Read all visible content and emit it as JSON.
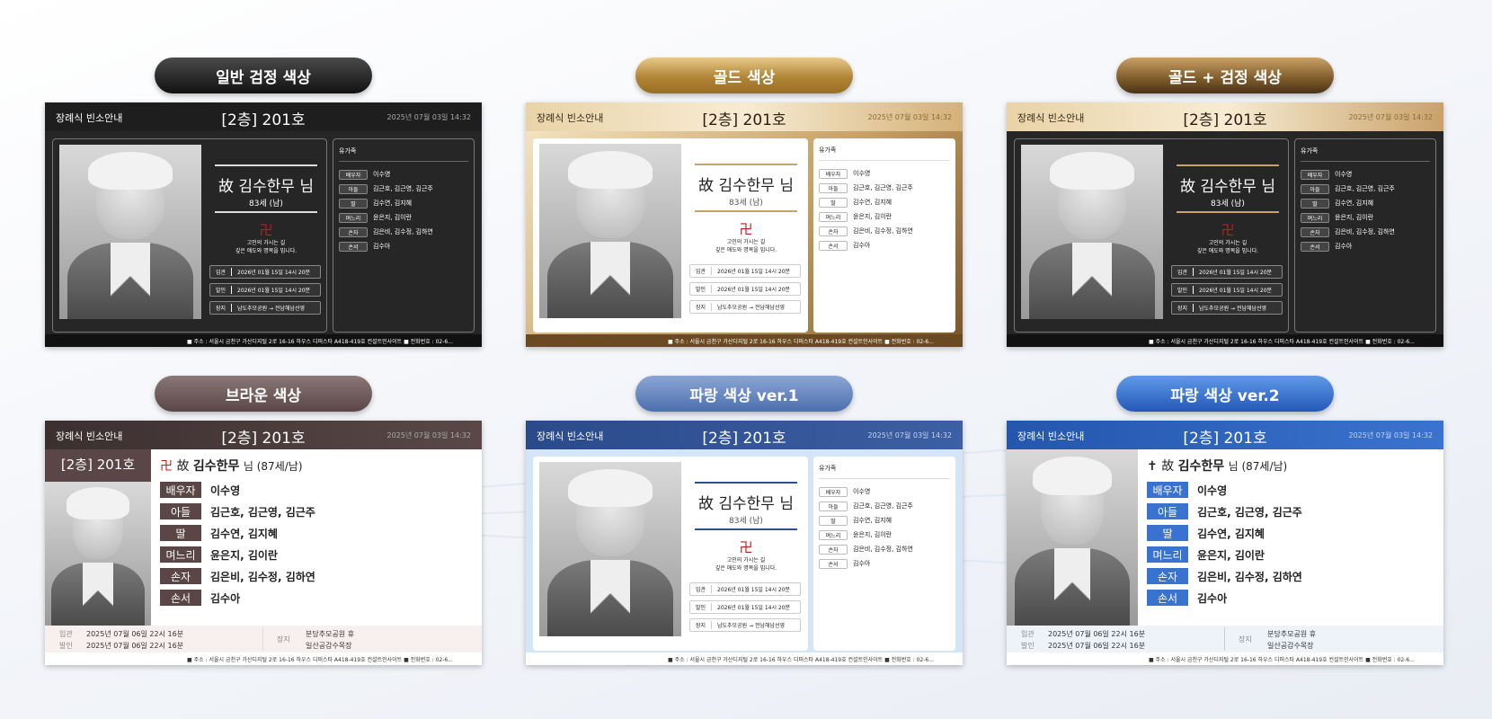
{
  "themes": [
    {
      "label": "일반 검정 색상",
      "brand": "장례식 빈소안내",
      "room": "[2층] 201호",
      "date": "2025년 07월 03일 14:32",
      "name": "故 김수한무 님",
      "age": "83세 (남)",
      "symbol": "卍",
      "message": "고인의 가시는 길\n깊은 애도와 명복을 빕니다.",
      "info": [
        {
          "k": "입관",
          "v": "2026년 01월 15일 14시 20분"
        },
        {
          "k": "발인",
          "v": "2026년 01월 15일 14시 20분"
        },
        {
          "k": "장지",
          "v": "남도추모공원 → 전남해남선영"
        }
      ],
      "family_title": "유가족",
      "family": [
        {
          "r": "배우자",
          "n": "이수영"
        },
        {
          "r": "아들",
          "n": "김근호, 김근영, 김근주"
        },
        {
          "r": "딸",
          "n": "김수연, 김지혜"
        },
        {
          "r": "며느리",
          "n": "윤은지, 김이란"
        },
        {
          "r": "손자",
          "n": "김은비, 김수정, 김하연"
        },
        {
          "r": "손서",
          "n": "김수아"
        }
      ],
      "footer": "■ 주소 : 서울시 금천구 가산디지털 2로 16-16 하우스 디퍼스타 A418-419호 컨설트인사이트    ■ 전화번호 : 02-6..."
    },
    {
      "label": "골드 색상",
      "brand": "장례식 빈소안내",
      "room": "[2층] 201호",
      "date": "2025년 07월 03일 14:32",
      "name": "故 김수한무 님",
      "age": "83세 (남)",
      "symbol": "卍",
      "message": "고인의 가시는 길\n깊은 애도와 명복을 빕니다.",
      "info": [
        {
          "k": "입관",
          "v": "2026년 01월 15일 14시 20분"
        },
        {
          "k": "발인",
          "v": "2026년 01월 15일 14시 20분"
        },
        {
          "k": "장지",
          "v": "남도추모공원 → 전남해남선영"
        }
      ],
      "family_title": "유가족",
      "family": [
        {
          "r": "배우자",
          "n": "이수영"
        },
        {
          "r": "아들",
          "n": "김근호, 김근영, 김근주"
        },
        {
          "r": "딸",
          "n": "김수연, 김지혜"
        },
        {
          "r": "며느리",
          "n": "윤은지, 김이란"
        },
        {
          "r": "손자",
          "n": "김은비, 김수정, 김하연"
        },
        {
          "r": "손서",
          "n": "김수아"
        }
      ],
      "footer": "■ 주소 : 서울시 금천구 가산디지털 2로 16-16 하우스 디퍼스타 A418-419호 컨설트인사이트    ■ 전화번호 : 02-6..."
    },
    {
      "label": "골드 + 검정 색상",
      "brand": "장례식 빈소안내",
      "room": "[2층] 201호",
      "date": "2025년 07월 03일 14:32",
      "name": "故 김수한무 님",
      "age": "83세 (남)",
      "symbol": "卍",
      "message": "고인의 가시는 길\n깊은 애도와 명복을 빕니다.",
      "info": [
        {
          "k": "입관",
          "v": "2026년 01월 15일 14시 20분"
        },
        {
          "k": "발인",
          "v": "2026년 01월 15일 14시 20분"
        },
        {
          "k": "장지",
          "v": "남도추모공원 → 전남해남선영"
        }
      ],
      "family_title": "유가족",
      "family": [
        {
          "r": "배우자",
          "n": "이수영"
        },
        {
          "r": "아들",
          "n": "김근호, 김근영, 김근주"
        },
        {
          "r": "딸",
          "n": "김수연, 김지혜"
        },
        {
          "r": "며느리",
          "n": "윤은지, 김이란"
        },
        {
          "r": "손자",
          "n": "김은비, 김수정, 김하연"
        },
        {
          "r": "손서",
          "n": "김수아"
        }
      ],
      "footer": "■ 주소 : 서울시 금천구 가산디지털 2로 16-16 하우스 디퍼스타 A418-419호 컨설트인사이트    ■ 전화번호 : 02-6..."
    },
    {
      "label": "브라운 색상",
      "brand": "장례식 빈소안내",
      "room": "[2층] 201호",
      "date": "2025년 07월 03일 14:32",
      "side_room": "[2층] 201호",
      "symbol": "卍",
      "name_prefix": "故",
      "name": "김수한무",
      "name_suffix": "님 (87세/남)",
      "family": [
        {
          "r": "배우자",
          "n": "이수영"
        },
        {
          "r": "아들",
          "n": "김근호, 김근영, 김근주"
        },
        {
          "r": "딸",
          "n": "김수연, 김지혜"
        },
        {
          "r": "며느리",
          "n": "윤은지, 김이란"
        },
        {
          "r": "손자",
          "n": "김은비, 김수정, 김하연"
        },
        {
          "r": "손서",
          "n": "김수아"
        }
      ],
      "info": [
        {
          "k": "입관",
          "v": "2025년 07월 06일 22시 16분"
        },
        {
          "k": "발인",
          "v": "2025년 07월 06일 22시 16분"
        }
      ],
      "burial_k": "장지",
      "burial_v1": "분당추모공원 휴",
      "burial_v2": "일산공감수목장",
      "footer": "■ 주소 : 서울시 금천구 가산디지털 2로 16-16 하우스 디퍼스타 A418-419호 컨설트인사이트    ■ 전화번호 : 02-6..."
    },
    {
      "label": "파랑 색상 ver.1",
      "brand": "장례식 빈소안내",
      "room": "[2층] 201호",
      "date": "2025년 07월 03일 14:32",
      "name": "故 김수한무 님",
      "age": "83세 (남)",
      "symbol": "卍",
      "message": "고인의 가시는 길\n깊은 애도와 명복을 빕니다.",
      "info": [
        {
          "k": "입관",
          "v": "2026년 01월 15일 14시 20분"
        },
        {
          "k": "발인",
          "v": "2026년 01월 15일 14시 20분"
        },
        {
          "k": "장지",
          "v": "남도추모공원 → 전남해남선영"
        }
      ],
      "family_title": "유가족",
      "family": [
        {
          "r": "배우자",
          "n": "이수영"
        },
        {
          "r": "아들",
          "n": "김근호, 김근영, 김근주"
        },
        {
          "r": "딸",
          "n": "김수연, 김지혜"
        },
        {
          "r": "며느리",
          "n": "윤은지, 김이란"
        },
        {
          "r": "손자",
          "n": "김은비, 김수정, 김하연"
        },
        {
          "r": "손서",
          "n": "김수아"
        }
      ],
      "footer": "■ 주소 : 서울시 금천구 가산디지털 2로 16-16 하우스 디퍼스타 A418-419호 컨설트인사이트    ■ 전화번호 : 02-6..."
    },
    {
      "label": "파랑 색상 ver.2",
      "brand": "장례식 빈소안내",
      "room": "[2층] 201호",
      "date": "2025년 07월 03일 14:32",
      "symbol": "✝",
      "name_prefix": "故",
      "name": "김수한무",
      "name_suffix": "님 (87세/남)",
      "family": [
        {
          "r": "배우자",
          "n": "이수영"
        },
        {
          "r": "아들",
          "n": "김근호, 김근영, 김근주"
        },
        {
          "r": "딸",
          "n": "김수연, 김지혜"
        },
        {
          "r": "며느리",
          "n": "윤은지, 김이란"
        },
        {
          "r": "손자",
          "n": "김은비, 김수정, 김하연"
        },
        {
          "r": "손서",
          "n": "김수아"
        }
      ],
      "info": [
        {
          "k": "입관",
          "v": "2025년 07월 06일 22시 16분"
        },
        {
          "k": "발인",
          "v": "2025년 07월 06일 22시 16분"
        }
      ],
      "burial_k": "장지",
      "burial_v1": "분당추모공원 휴",
      "burial_v2": "일산공감수목장",
      "footer": "■ 주소 : 서울시 금천구 가산디지털 2로 16-16 하우스 디퍼스타 A418-419호 컨설트인사이트    ■ 전화번호 : 02-6..."
    }
  ],
  "colors": {
    "black": "#2b2b2b",
    "gold": "#c9a26a",
    "brown": "#4a3a3a",
    "blue1": "#2f4f8f",
    "blue2": "#2c63b8",
    "red": "#c41a1a"
  }
}
